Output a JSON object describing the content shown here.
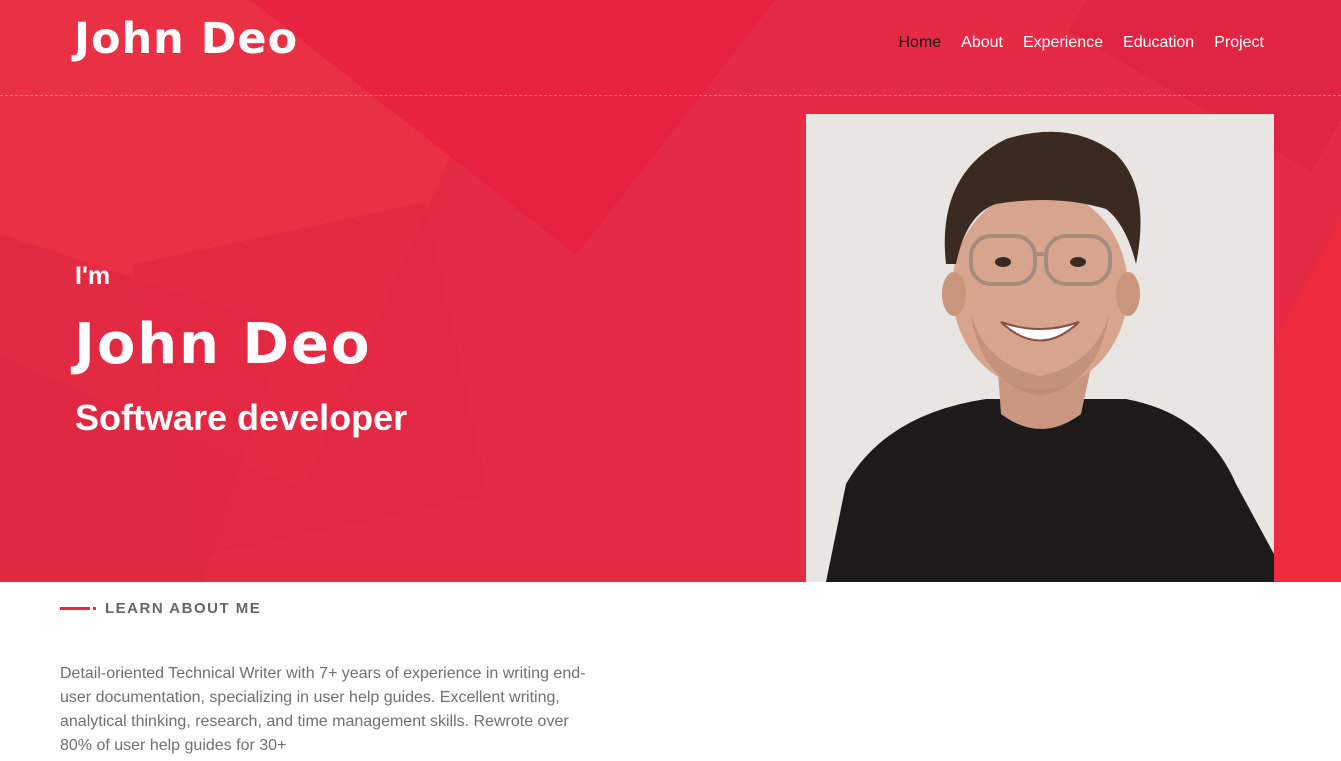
{
  "header": {
    "logo": "John Deo",
    "nav": [
      "Home",
      "About",
      "Experience",
      "Education",
      "Project"
    ],
    "active_nav": "Home"
  },
  "hero": {
    "greeting": "I'm",
    "name": "John Deo",
    "role": "Software developer",
    "photo_icon": "portrait-photo"
  },
  "about": {
    "label": "LEARN ABOUT ME",
    "text": "Detail-oriented Technical Writer with 7+ years of experience in writing end-user documentation, specializing in user help guides. Excellent writing, analytical thinking, research, and time management skills. Rewrote over 80% of user help guides for 30+"
  },
  "colors": {
    "accent": "#e42a45",
    "hero_bg": "#e42a45",
    "text_muted": "#707070"
  }
}
